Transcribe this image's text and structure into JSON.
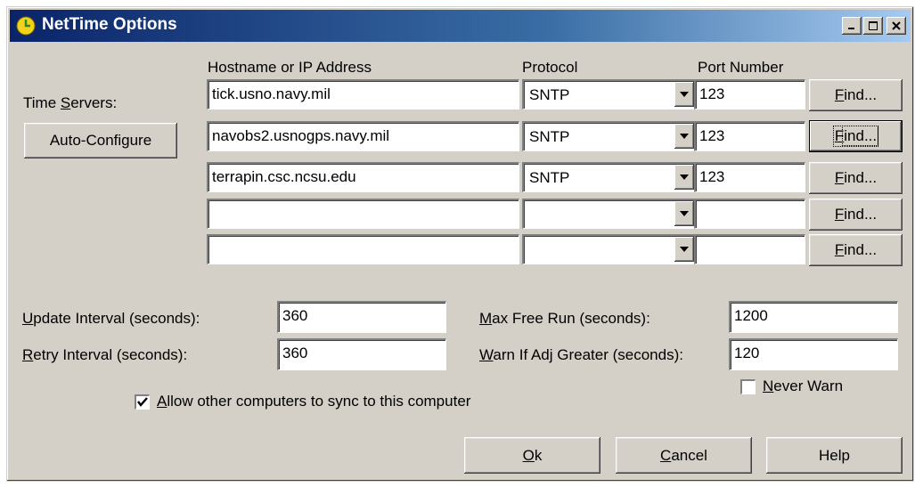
{
  "window": {
    "title": "NetTime Options"
  },
  "headers": {
    "hostname": "Hostname or IP Address",
    "protocol": "Protocol",
    "port": "Port Number"
  },
  "time_servers": {
    "label_pre": "Time ",
    "label_ul": "S",
    "label_post": "ervers:"
  },
  "auto_configure_label": "Auto-Configure",
  "find": {
    "ul": "F",
    "rest": "ind..."
  },
  "servers": [
    {
      "host": "tick.usno.navy.mil",
      "protocol": "SNTP",
      "port": "123"
    },
    {
      "host": "navobs2.usnogps.navy.mil",
      "protocol": "SNTP",
      "port": "123"
    },
    {
      "host": "terrapin.csc.ncsu.edu",
      "protocol": "SNTP",
      "port": "123"
    },
    {
      "host": "",
      "protocol": "",
      "port": ""
    },
    {
      "host": "",
      "protocol": "",
      "port": ""
    }
  ],
  "update_interval": {
    "ul": "U",
    "rest": "pdate Interval (seconds):",
    "value": "360"
  },
  "retry_interval": {
    "ul": "R",
    "rest": "etry Interval (seconds):",
    "value": "360"
  },
  "max_free_run": {
    "ul": "M",
    "rest": "ax Free Run (seconds):",
    "value": "1200"
  },
  "warn_if_adj": {
    "ul": "W",
    "rest": "arn If Adj Greater (seconds):",
    "value": "120"
  },
  "never_warn": {
    "ul": "N",
    "rest": "ever Warn",
    "checked": false
  },
  "allow_sync": {
    "ul": "A",
    "rest": "llow other computers to sync to this computer",
    "checked": true
  },
  "ok": {
    "ul": "O",
    "rest": "k"
  },
  "cancel": {
    "ul": "C",
    "rest": "ancel"
  },
  "help_label": "Help"
}
